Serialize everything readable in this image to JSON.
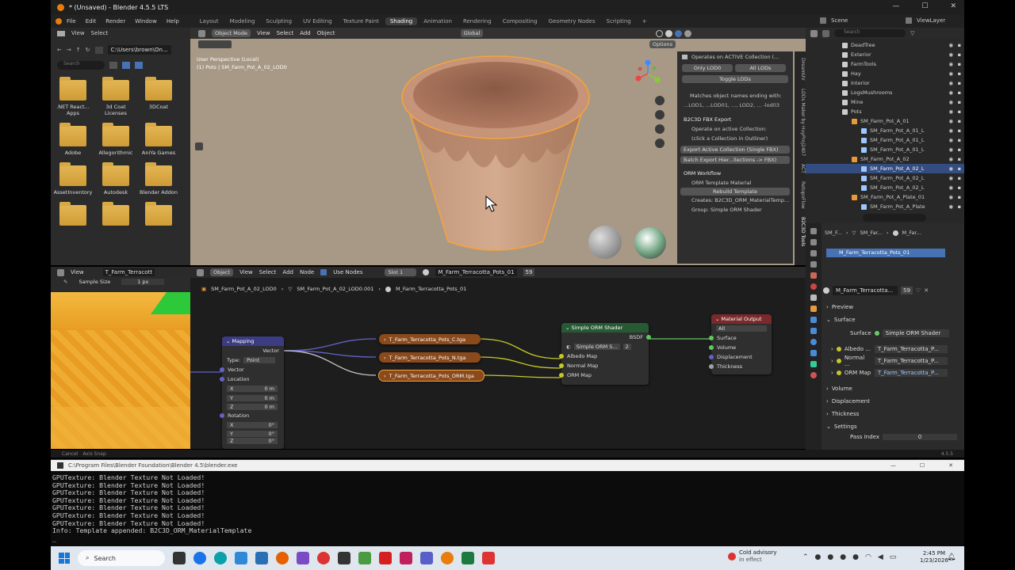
{
  "window": {
    "title": "* (Unsaved) - Blender 4.5.5 LTS"
  },
  "menu": [
    "File",
    "Edit",
    "Render",
    "Window",
    "Help"
  ],
  "workspaces": [
    "Layout",
    "Modeling",
    "Sculpting",
    "UV Editing",
    "Texture Paint",
    "Shading",
    "Animation",
    "Rendering",
    "Compositing",
    "Geometry Nodes",
    "Scripting"
  ],
  "active_workspace": "Shading",
  "scene": {
    "name": "Scene",
    "view_layer": "ViewLayer"
  },
  "file_browser": {
    "menu": [
      "View",
      "Select"
    ],
    "path": "C:\\Users\\brown\\On...",
    "search_placeholder": "Search",
    "folders": [
      ".NET React... Apps",
      "3d Coat Licenses",
      "3DCoat",
      "Adobe",
      "Allegorithmic",
      "AniYa Games",
      "AssetInventory",
      "Autodesk",
      "Blender Addon",
      "",
      "",
      ""
    ]
  },
  "viewport": {
    "mode": "Object Mode",
    "menu": [
      "View",
      "Select",
      "Add",
      "Object"
    ],
    "transform": "Global",
    "info_line1": "User Perspective (Local)",
    "info_line2": "(1) Pots | SM_Farm_Pot_A_02_LOD0",
    "options": "Options"
  },
  "npanel": {
    "lod_header": "Operates on ACTIVE Collection (...",
    "only_lod0": "Only LOD0",
    "all_lods": "All LODs",
    "toggle_lods": "Toggle LODs",
    "matches": "Matches object names ending with:",
    "suffixes": "...LOD1, ...LOD01, ..., LOD2, ... -lod03",
    "fbx_title": "B2C3D FBX Export",
    "fbx_info1": "Operate on active Collection:",
    "fbx_info2": "(click a Collection in Outliner)",
    "export_active": "Export Active Collection (Single FBX)",
    "batch_export": "Batch Export Hier...llections -> FBX)",
    "orm_title": "ORM Workflow",
    "orm_template": "ORM Template Material",
    "rebuild": "Rebuild Template",
    "creates": "Creates: B2C3D_ORM_MaterialTemp...",
    "group": "Group: Simple ORM Shader",
    "tabs": [
      "DreamUV",
      "LODs Maker by HuyProj2407",
      "ACT",
      "RetopoFlow",
      "B2C3D Tools"
    ]
  },
  "outliner": {
    "search_placeholder": "Search",
    "items": [
      {
        "label": "DeadTree",
        "indent": 0
      },
      {
        "label": "Exterior",
        "indent": 0
      },
      {
        "label": "FarmTools",
        "indent": 0
      },
      {
        "label": "Hay",
        "indent": 0
      },
      {
        "label": "Interior",
        "indent": 0
      },
      {
        "label": "LogsMushrooms",
        "indent": 0
      },
      {
        "label": "Mine",
        "indent": 0
      },
      {
        "label": "Pots",
        "indent": 0
      },
      {
        "label": "SM_Farm_Pot_A_01",
        "indent": 1
      },
      {
        "label": "SM_Farm_Pot_A_01_L",
        "indent": 2
      },
      {
        "label": "SM_Farm_Pot_A_01_L",
        "indent": 2
      },
      {
        "label": "SM_Farm_Pot_A_01_L",
        "indent": 2
      },
      {
        "label": "SM_Farm_Pot_A_02",
        "indent": 1
      },
      {
        "label": "SM_Farm_Pot_A_02_L",
        "indent": 2,
        "selected": true
      },
      {
        "label": "SM_Farm_Pot_A_02_L",
        "indent": 2
      },
      {
        "label": "SM_Farm_Pot_A_02_L",
        "indent": 2
      },
      {
        "label": "SM_Farm_Pot_A_Plate_01",
        "indent": 1
      },
      {
        "label": "SM_Farm_Pot_A_Plate",
        "indent": 2
      }
    ]
  },
  "properties": {
    "breadcrumb": [
      "SM_F...",
      "SM_Far...",
      "M_Far..."
    ],
    "material_slot": "M_Farm_Terracotta_Pots_01",
    "material_name": "M_Farm_Terracotta...",
    "users": "59",
    "preview": "Preview",
    "surface_section": "Surface",
    "surface_label": "Surface",
    "surface_value": "Simple ORM Shader",
    "inputs": [
      {
        "label": "Albedo ...",
        "value": "T_Farm_Terracotta_P..."
      },
      {
        "label": "Normal ...",
        "value": "T_Farm_Terracotta_P..."
      },
      {
        "label": "ORM Map",
        "value": "T_Farm_Terracotta_P..."
      }
    ],
    "volume": "Volume",
    "displacement": "Displacement",
    "thickness": "Thickness",
    "settings": "Settings",
    "pass_index_label": "Pass Index",
    "pass_index": "0",
    "version": "4.5.5"
  },
  "image_editor": {
    "menu": [
      "View"
    ],
    "image": "T_Farm_Terracott",
    "sample_label": "Sample Size",
    "sample_value": "1 px"
  },
  "node_editor": {
    "menu": [
      "Object",
      "View",
      "Select",
      "Add",
      "Node"
    ],
    "use_nodes": "Use Nodes",
    "slot": "Slot 1",
    "material": "M_Farm_Terracotta_Pots_01",
    "users": "59",
    "breadcrumb": [
      "SM_Farm_Pot_A_02_LOD0",
      "SM_Farm_Pot_A_02_LOD0.001",
      "M_Farm_Terracotta_Pots_01"
    ],
    "mapping": {
      "title": "Mapping",
      "vector_out": "Vector",
      "type_label": "Type:",
      "type_value": "Point",
      "vector_in": "Vector",
      "location": "Location",
      "lx": "0 m",
      "ly": "0 m",
      "lz": "0 m",
      "rotation": "Rotation",
      "rx": "0°",
      "ry": "0°",
      "rz": "0°"
    },
    "tex_c": "T_Farm_Terracotta_Pots_C.tga",
    "tex_n": "T_Farm_Terracotta_Pots_N.tga",
    "tex_orm": "T_Farm_Terracotta_Pots_ORM.tga",
    "orm_shader": {
      "title": "Simple ORM Shader",
      "bsdf": "BSDF",
      "group": "Simple ORM S...",
      "users": "2",
      "albedo": "Albedo Map",
      "normal": "Normal Map",
      "orm": "ORM Map"
    },
    "output": {
      "title": "Material Output",
      "target": "All",
      "surface": "Surface",
      "volume": "Volume",
      "displacement": "Displacement",
      "thickness": "Thickness"
    }
  },
  "status": {
    "cancel": "Cancel",
    "axis_snap": "Axis Snap"
  },
  "console": {
    "title": "C:\\Program Files\\Blender Foundation\\Blender 4.5\\blender.exe",
    "lines": [
      "GPUTexture: Blender Texture Not Loaded!",
      "GPUTexture: Blender Texture Not Loaded!",
      "GPUTexture: Blender Texture Not Loaded!",
      "GPUTexture: Blender Texture Not Loaded!",
      "GPUTexture: Blender Texture Not Loaded!",
      "GPUTexture: Blender Texture Not Loaded!",
      "GPUTexture: Blender Texture Not Loaded!",
      "Info: Template appended: B2C3D_ORM_MaterialTemplate"
    ]
  },
  "taskbar": {
    "search": "Search",
    "weather_title": "Cold advisory",
    "weather_sub": "In effect",
    "time": "2:45 PM",
    "date": "1/23/2026"
  }
}
